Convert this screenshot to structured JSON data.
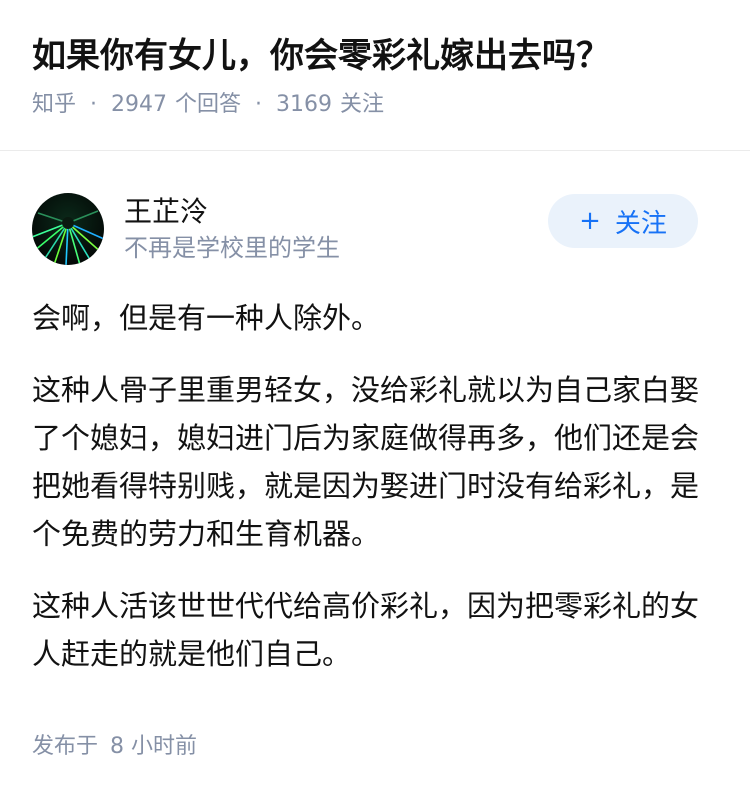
{
  "question": {
    "title": "如果你有女儿，你会零彩礼嫁出去吗？",
    "source": "知乎",
    "answers_count": "2947",
    "answers_label": "个回答",
    "followers_count": "3169",
    "followers_label": "关注",
    "separator": "·"
  },
  "author": {
    "name": "王芷泠",
    "bio": "不再是学校里的学生",
    "follow_plus": "+",
    "follow_label": "关注",
    "avatar_icon": "abstract-green-light-avatar"
  },
  "answer": {
    "paragraphs": [
      "会啊，但是有一种人除外。",
      "这种人骨子里重男轻女，没给彩礼就以为自己家白娶了个媳妇，媳妇进门后为家庭做得再多，他们还是会把她看得特别贱，就是因为娶进门时没有给彩礼，是个免费的劳力和生育机器。",
      "这种人活该世世代代给高价彩礼，因为把零彩礼的女人赶走的就是他们自己。"
    ],
    "published_label": "发布于",
    "published_time": "8 小时前"
  },
  "colors": {
    "text": "#121212",
    "meta": "#8590a6",
    "accent": "#1772f6",
    "button_bg": "#eaf2fb"
  }
}
